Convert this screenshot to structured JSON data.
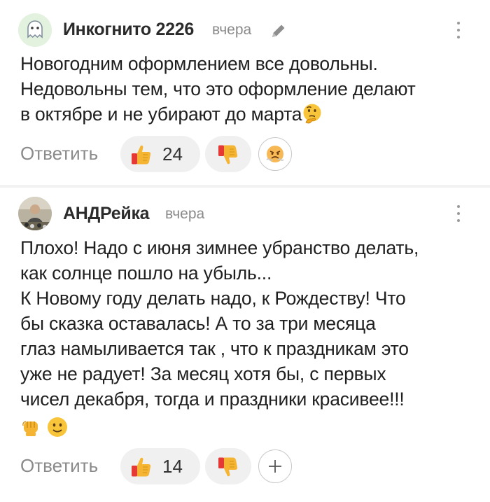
{
  "comments": [
    {
      "username": "Инкогнито 2226",
      "time": "вчера",
      "avatar": "ghost-icon",
      "text": "Новогодним оформлением все довольны.\nНедовольны тем, что это оформление делают\nв октябре и не убирают до марта",
      "text_emoji": "thinking-face-emoji",
      "reply_label": "Ответить",
      "likes": "24",
      "reaction": "angry-face-emoji"
    },
    {
      "username": "АНДРейка",
      "time": "вчера",
      "avatar": "user-photo",
      "text": "Плохо! Надо с июня зимнее убранство делать,\nкак солнце пошло на убыль...\nК Новому году делать надо, к Рождеству! Что\nбы сказка оставалась! А то за три месяца\nглаз намыливается так , что к праздникам это\nуже не радует! За месяц хотя бы, с первых\nчисел декабря, тогда и праздники красивее!!!",
      "text_emojis": [
        "raised-fist-emoji",
        "slightly-smiling-face-emoji"
      ],
      "reply_label": "Ответить",
      "likes": "14",
      "reaction": "plus-icon"
    }
  ],
  "colors": {
    "muted": "#8a8a8a",
    "pill_bg": "#f0f0f0",
    "thumb": "#f5b431",
    "thumb_down": "#e53935"
  }
}
